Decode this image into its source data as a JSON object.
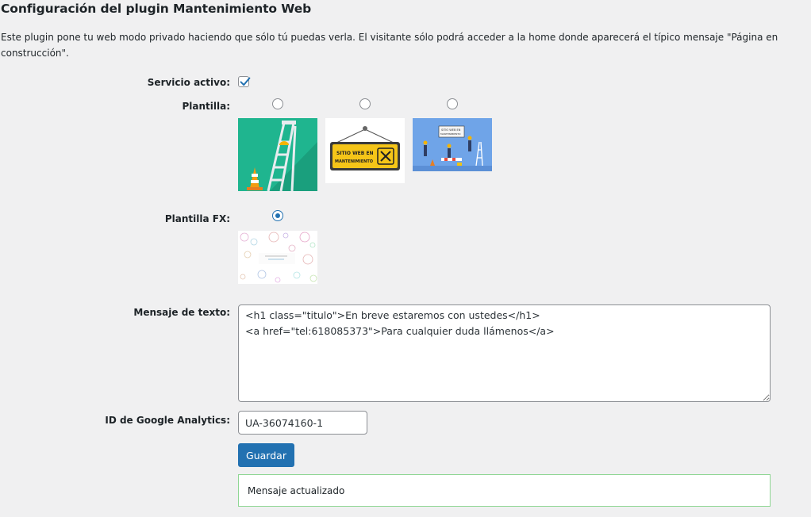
{
  "page": {
    "title": "Configuración del plugin Mantenimiento Web",
    "description": "Este plugin pone tu web modo privado haciendo que sólo tú puedas verla. El visitante sólo podrá acceder a la home donde aparecerá el típico mensaje \"Página en construcción\"."
  },
  "form": {
    "service_label": "Servicio activo:",
    "service_checked": true,
    "template_label": "Plantilla:",
    "templates": [
      {
        "name": "ladder-cone",
        "selected": false
      },
      {
        "name": "sitio-web-en-mantenimiento-sign",
        "selected": false,
        "text": "SITIO WEB EN MANTENIMIENTO"
      },
      {
        "name": "workers-illustration",
        "selected": false,
        "text": "SITIO WEB EN MANTENIMIENTO"
      }
    ],
    "template_fx_label": "Plantilla FX:",
    "template_fx_selected": true,
    "message_label": "Mensaje de texto:",
    "message_value": "<h1 class=\"titulo\">En breve estaremos con ustedes</h1>\n<a href=\"tel:618085373\">Para cualquier duda llámenos</a>",
    "ga_label": "ID de Google Analytics:",
    "ga_value": "UA-36074160-1",
    "save_label": "Guardar",
    "notice": "Mensaje actualizado"
  },
  "colors": {
    "accent": "#2271b1",
    "notice_border": "#8fd694",
    "thumb_green": "#1fb58f",
    "thumb_blue": "#6fa4e8",
    "sign_yellow": "#f5c518"
  }
}
